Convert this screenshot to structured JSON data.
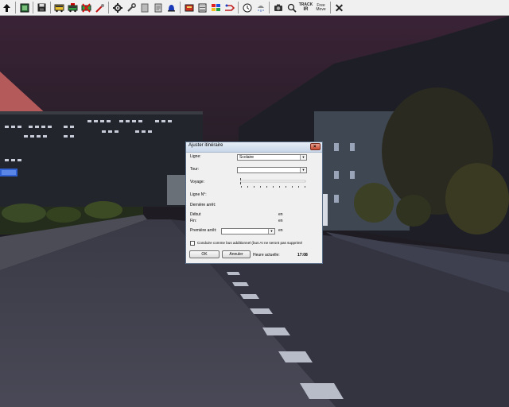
{
  "toolbar": {
    "icons": [
      "up-arrow-icon",
      "map-icon",
      "save-icon",
      "bus-icon",
      "bus-new-icon",
      "bus-delete-icon",
      "repair-icon",
      "wrench-icon",
      "page-icon",
      "document-icon",
      "flashing-light-icon",
      "schedule-book-icon",
      "timetable-icon",
      "bus-colored-icon",
      "route-icon",
      "clock-icon",
      "weather-icon",
      "camera-icon",
      "zoom-icon",
      "track-ir-icon",
      "free-move-icon",
      "close-icon"
    ],
    "track_ir_line1": "TRACK",
    "track_ir_line2": "IR",
    "free_move_line1": "Free",
    "free_move_line2": "Move",
    "close_glyph": "✕"
  },
  "dialog": {
    "title": "Ajuster itinéraire",
    "close_glyph": "×",
    "ligne_label": "Ligne:",
    "ligne_value": "Scolaire",
    "tour_label": "Tour:",
    "tour_value": "",
    "voyage_label": "Voyage:",
    "ligne_no_label": "Ligne N°:",
    "ligne_no_value": "",
    "derniere_arret_label": "Dernière arrêt:",
    "debut_label": "Début",
    "debut_en": "en",
    "fin_label": "Fin:",
    "fin_en": "en",
    "premiere_arret_label": "Première arrêt:",
    "premiere_arret_value": "",
    "premiere_en": "en",
    "checkbox_label": "Conduire comme bus additionnel (bus AI ne seront pas supprimé",
    "checkbox_checked": false,
    "ok_label": "OK",
    "annuler_label": "Annuler",
    "heure_label": "Heure actuelle:",
    "heure_value": "17:08"
  }
}
